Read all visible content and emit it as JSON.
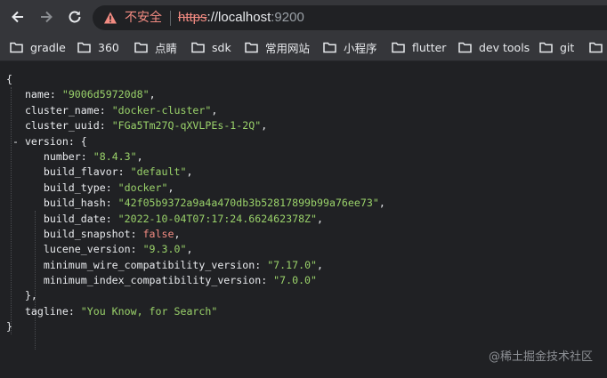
{
  "browser": {
    "security_label": "不安全",
    "url": {
      "scheme": "https",
      "rest": "://localhost",
      "port": ":9200"
    }
  },
  "bookmarks": [
    "gradle",
    "360",
    "点睛",
    "sdk",
    "常用网站",
    "小程序",
    "flutter",
    "dev tools",
    "git"
  ],
  "json": {
    "open": "{",
    "name": "\"9006d59720d8\"",
    "cluster_name": "\"docker-cluster\"",
    "cluster_uuid": "\"FGa5Tm27Q-qXVLPEs-1-2Q\"",
    "version_toggle": "-",
    "version_open": "{",
    "number": "\"8.4.3\"",
    "build_flavor": "\"default\"",
    "build_type": "\"docker\"",
    "build_hash": "\"42f05b9372a9a4a470db3b52817899b99a76ee73\"",
    "build_date": "\"2022-10-04T07:17:24.662462378Z\"",
    "build_snapshot": "false",
    "lucene_version": "\"9.3.0\"",
    "minimum_wire_compatibility_version": "\"7.17.0\"",
    "minimum_index_compatibility_version": "\"7.0.0\"",
    "version_close": "},",
    "tagline": "\"You Know, for Search\"",
    "close": "}"
  },
  "keys": {
    "name": "name:",
    "cluster_name": "cluster_name:",
    "cluster_uuid": "cluster_uuid:",
    "version": "version:",
    "number": "number:",
    "build_flavor": "build_flavor:",
    "build_type": "build_type:",
    "build_hash": "build_hash:",
    "build_date": "build_date:",
    "build_snapshot": "build_snapshot:",
    "lucene_version": "lucene_version:",
    "minimum_wire_compatibility_version": "minimum_wire_compatibility_version:",
    "minimum_index_compatibility_version": "minimum_index_compatibility_version:",
    "tagline": "tagline:"
  },
  "watermark": "@稀土掘金技术社区"
}
